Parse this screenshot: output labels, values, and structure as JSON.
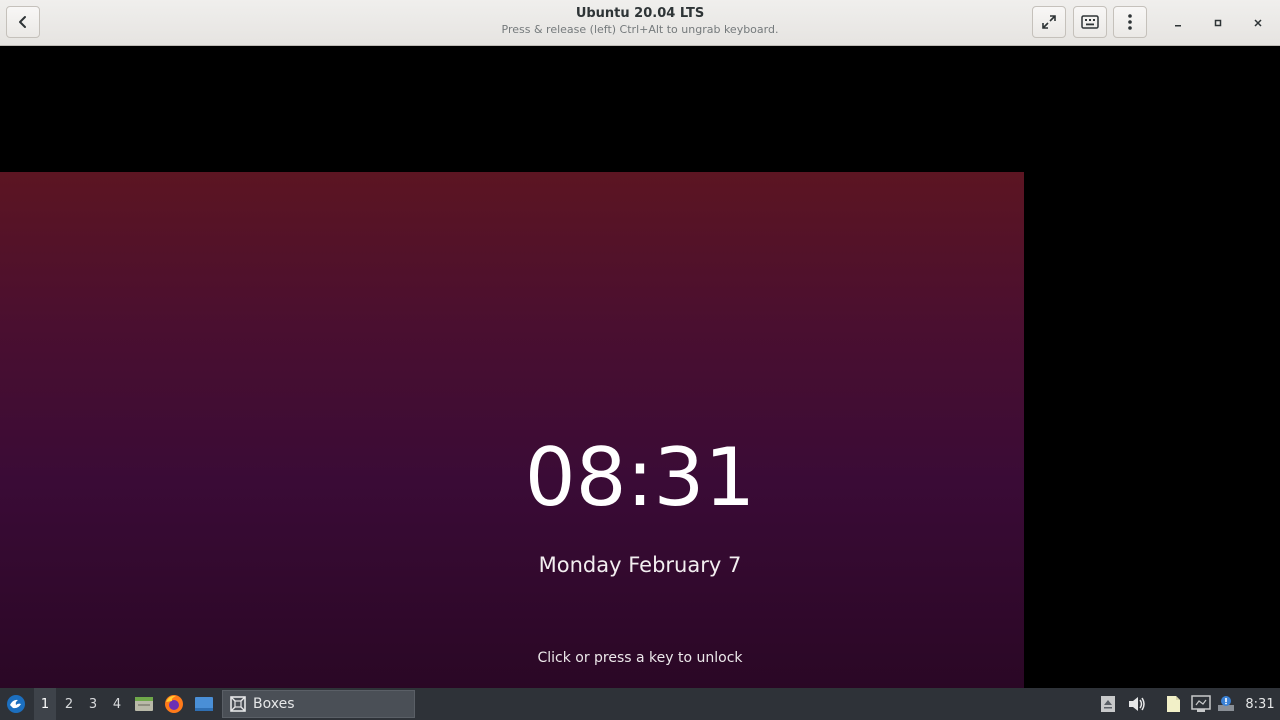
{
  "window": {
    "title": "Ubuntu 20.04 LTS",
    "subtitle": "Press & release (left) Ctrl+Alt to ungrab keyboard."
  },
  "lockscreen": {
    "time": "08:31",
    "date": "Monday February 7",
    "hint": "Click or press a key to unlock"
  },
  "taskbar": {
    "workspaces": [
      "1",
      "2",
      "3",
      "4"
    ],
    "active_workspace": "1",
    "task_label": "Boxes",
    "clock": "8:31"
  },
  "colors": {
    "taskbar": "#2e3238",
    "wallpaper_top": "#5c1522",
    "wallpaper_bottom": "#2a0725"
  }
}
